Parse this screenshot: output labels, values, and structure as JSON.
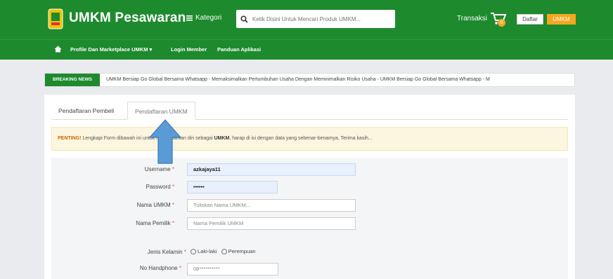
{
  "header": {
    "brand": "UMKM Pesawaran",
    "kategori_label": "Kategori",
    "search_placeholder": "Ketik Disini Untuk Mencari Produk UMKM...",
    "transaksi_label": "Transaksi",
    "cart_count": "0",
    "daftar_label": "Daftar",
    "umkm_label": "UMKM"
  },
  "nav": {
    "items": [
      {
        "label": "Profile Dan Marketplace UMKM ▾"
      },
      {
        "label": "Login Member"
      },
      {
        "label": "Panduan Aplikasi"
      }
    ]
  },
  "breaking_news": {
    "label": "BREAKING NEWS",
    "text": "UMKM Bersiap Go Global Bersama Whatsapp  -  Memaksimalkan Pertumbuhan Usaha Dengan Meminimalkan Risiko Usaha  -  UMKM Bersiap Go Global Bersama Whatsapp  -  M"
  },
  "tabs": [
    {
      "label": "Pendaftaran Pembeli"
    },
    {
      "label": "Pendaftaran UMKM"
    }
  ],
  "alert": {
    "prefix": "PENTING!",
    "text_1": " Lengkapi Form dibawah ini untuk mendaftarkan diri sebagai ",
    "highlight": "UMKM",
    "text_2": ", harap di isi dengan data yang sebenar-benarnya, Terima kasih..."
  },
  "form": {
    "username_label": "Username",
    "username_value": "azkajaya11",
    "password_label": "Password",
    "password_value": "••••••",
    "nama_umkm_label": "Nama UMKM",
    "nama_umkm_placeholder": "Tuliskan Nama UMKM,..",
    "nama_pemilik_label": "Nama Pemilik",
    "nama_pemilik_placeholder": "Nama Pemilik UMKM",
    "jenis_kelamin_label": "Jenis Kelamin",
    "option_laki": "Laki-laki",
    "option_perempuan": "Perempuan",
    "hp_label": "No Handphone",
    "hp_placeholder": "08**********",
    "required_mark": "*"
  },
  "colors": {
    "header_green": "#1e8a2e",
    "accent_orange": "#f4a81f",
    "arrow_blue": "#5b9bd5"
  }
}
